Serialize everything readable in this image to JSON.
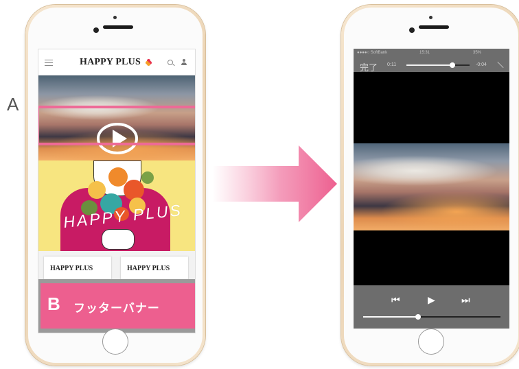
{
  "labels": {
    "a": "A"
  },
  "left_phone": {
    "header": {
      "logo_text": "HAPPY PLUS",
      "icons": [
        "hamburger-menu-icon",
        "search-icon",
        "user-icon"
      ]
    },
    "video": {
      "icon": "play-circle-icon"
    },
    "illustration_text": "HAPPY PLUS",
    "cards": [
      {
        "logo_text": "HAPPY PLUS"
      },
      {
        "logo_text": "HAPPY PLUS"
      }
    ],
    "footer_banner": {
      "letter": "B",
      "text": "フッターバナー"
    }
  },
  "right_phone": {
    "status_bar": {
      "carrier": "●●●●○ SoftBank",
      "time": "15:31",
      "battery": "35%"
    },
    "player": {
      "done_label": "完了",
      "time_elapsed": "0:11",
      "time_remaining": "-0:04",
      "progress": 0.73,
      "volume": 0.4
    },
    "controls": {
      "icons": [
        "skip-back-icon",
        "play-icon",
        "skip-forward-icon"
      ]
    }
  },
  "colors": {
    "accent_pink": "#ed5f8f",
    "highlight_pink": "#ee6a97",
    "clover_red": "#e8304e",
    "clover_orange": "#f5a02a",
    "phone_gold": "#ecd5b6"
  }
}
